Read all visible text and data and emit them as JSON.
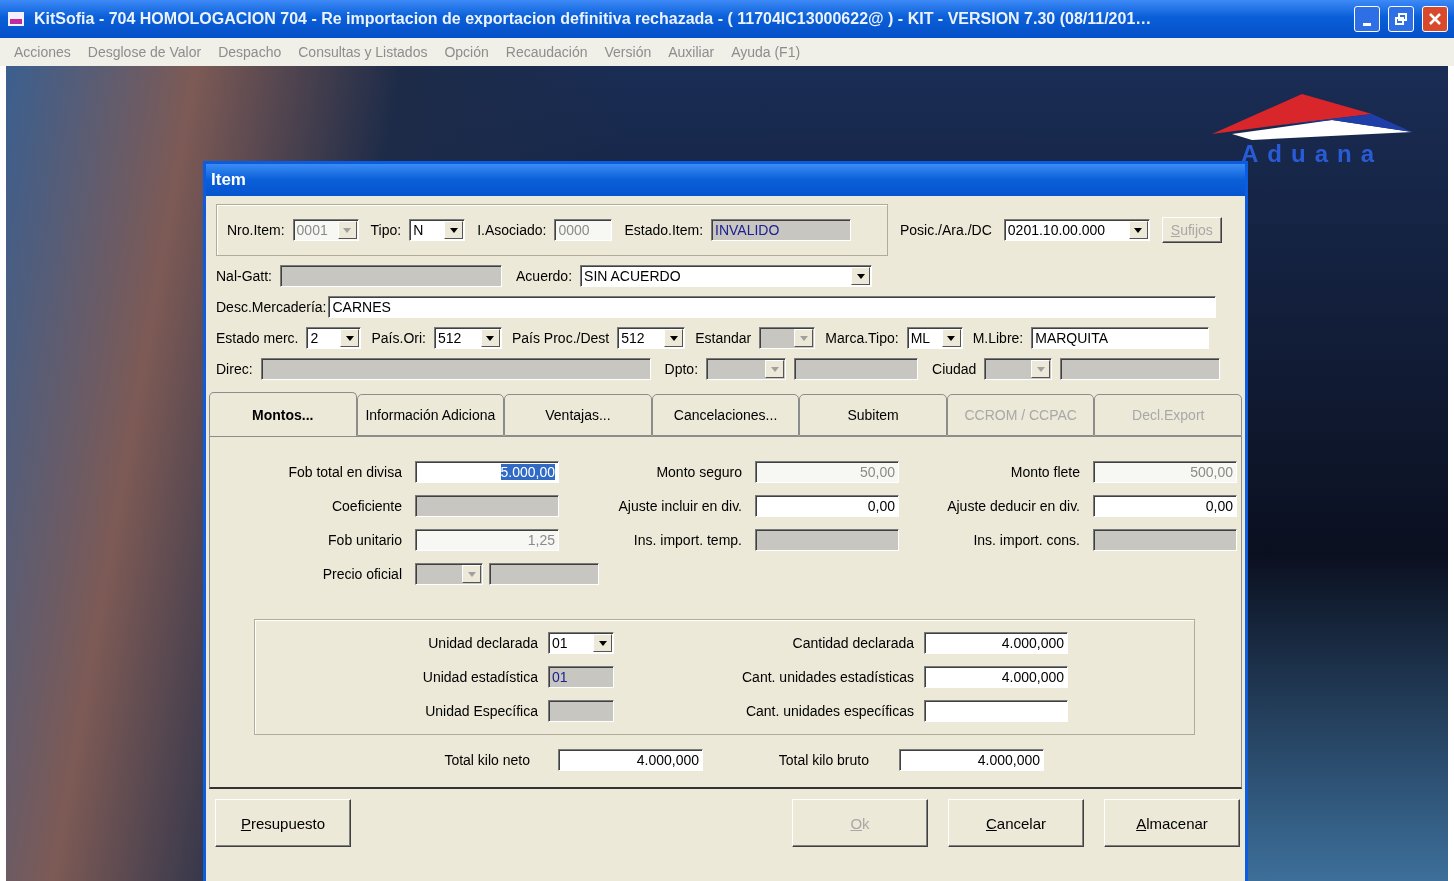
{
  "window": {
    "title": "KitSofia - 704 HOMOLOGACION 704 - Re importacion de exportacion definitiva rechazada - ( 11704IC13000622@ ) - KIT - VERSION 7.30 (08/11/201…"
  },
  "menu": [
    "Acciones",
    "Desglose de Valor",
    "Despacho",
    "Consultas y Listados",
    "Opción",
    "Recaudación",
    "Versión",
    "Auxiliar",
    "Ayuda (F1)"
  ],
  "logo": {
    "text": "Aduana"
  },
  "dialog": {
    "title": "Item",
    "header": {
      "nro_item": {
        "label": "Nro.Item:",
        "value": "0001",
        "disabled": true
      },
      "tipo": {
        "label": "Tipo:",
        "value": "N",
        "disabled": false
      },
      "asociado": {
        "label": "I.Asociado:",
        "value": "0000",
        "disabled": true
      },
      "estado_item": {
        "label": "Estado.Item:",
        "value": "INVALIDO",
        "readonly": true
      },
      "posicion": {
        "label": "Posic./Ara./DC",
        "value": "0201.10.00.000",
        "disabled": false
      },
      "sufijos": {
        "label": "Sufijos",
        "disabled": true
      },
      "nal_gatt": {
        "label": "Nal-Gatt:",
        "readonly": true
      },
      "acuerdo": {
        "label": "Acuerdo:",
        "value": "SIN ACUERDO",
        "disabled": false
      },
      "desc": {
        "label": "Desc.Mercadería:",
        "value": "CARNES",
        "disabled": false
      },
      "estado_merc": {
        "label": "Estado merc.",
        "value": "2",
        "disabled": false
      },
      "pais_ori": {
        "label": "País.Ori:",
        "value": "512",
        "disabled": false
      },
      "pais_proc": {
        "label": "País Proc./Dest",
        "value": "512",
        "disabled": false
      },
      "estandar": {
        "label": "Estandar",
        "disabled": true
      },
      "marca_tipo": {
        "label": "Marca.Tipo:",
        "value": "ML",
        "disabled": false
      },
      "m_libre": {
        "label": "M.Libre:",
        "value": "MARQUITA",
        "disabled": false
      },
      "direc": {
        "label": "Direc:",
        "readonly": true
      },
      "dpto": {
        "label": "Dpto:",
        "disabled": true
      },
      "ciudad": {
        "label": "Ciudad",
        "disabled": true
      }
    },
    "tabs": [
      {
        "label": "Montos...",
        "selected": true,
        "disabled": false
      },
      {
        "label": "Información Adiciona",
        "selected": false,
        "disabled": false
      },
      {
        "label": "Ventajas...",
        "selected": false,
        "disabled": false
      },
      {
        "label": "Cancelaciones...",
        "selected": false,
        "disabled": false
      },
      {
        "label": "Subitem",
        "selected": false,
        "disabled": false
      },
      {
        "label": "CCROM / CCPAC",
        "selected": false,
        "disabled": true
      },
      {
        "label": "Decl.Export",
        "selected": false,
        "disabled": true
      }
    ],
    "amounts": [
      {
        "kind": "text",
        "label": "Fob total en divisa",
        "value": "5.000,00",
        "disabled": false,
        "readonly": false,
        "highlighted": true
      },
      {
        "kind": "text",
        "label": "Monto seguro",
        "value": "50,00",
        "disabled": true,
        "readonly": false
      },
      {
        "kind": "text",
        "label": "Monto flete",
        "value": "500,00",
        "disabled": true,
        "readonly": false
      },
      {
        "kind": "text",
        "label": "Coeficiente",
        "disabled": false,
        "readonly": true
      },
      {
        "kind": "text",
        "label": "Ajuste incluir en div.",
        "value": "0,00",
        "disabled": false,
        "readonly": false
      },
      {
        "kind": "text",
        "label": "Ajuste deducir en div.",
        "value": "0,00",
        "disabled": false,
        "readonly": false
      },
      {
        "kind": "text",
        "label": "Fob unitario",
        "value": "1,25",
        "disabled": true,
        "readonly": false
      },
      {
        "kind": "text",
        "label": "Ins. import. temp.",
        "disabled": false,
        "readonly": true
      },
      {
        "kind": "text",
        "label": "Ins. import. cons.",
        "disabled": false,
        "readonly": true
      },
      {
        "kind": "combo_text",
        "label": "Precio oficial",
        "disabled": true,
        "readonly": true
      }
    ],
    "units": [
      {
        "kind": "combo",
        "label": "Unidad declarada",
        "value": "01",
        "disabled": false,
        "readonly": false
      },
      {
        "kind": "text",
        "label": "Unidad estadística",
        "value": "01",
        "disabled": false,
        "readonly": true
      },
      {
        "kind": "text",
        "label": "Unidad Específica",
        "disabled": false,
        "readonly": true
      }
    ],
    "quantities": [
      {
        "label": "Cantidad declarada",
        "value": "4.000,000"
      },
      {
        "label": "Cant. unidades estadísticas",
        "value": "4.000,000"
      },
      {
        "label": "Cant. unidades específicas"
      }
    ],
    "totals": [
      {
        "label": "Total kilo neto",
        "value": "4.000,000"
      },
      {
        "label": "Total kilo bruto",
        "value": "4.000,000"
      }
    ],
    "buttons": [
      {
        "label": "Presupuesto",
        "disabled": false
      },
      {
        "label": "Ok",
        "disabled": true
      },
      {
        "label": "Cancelar",
        "disabled": false
      },
      {
        "label": "Almacenar",
        "disabled": false
      }
    ]
  }
}
